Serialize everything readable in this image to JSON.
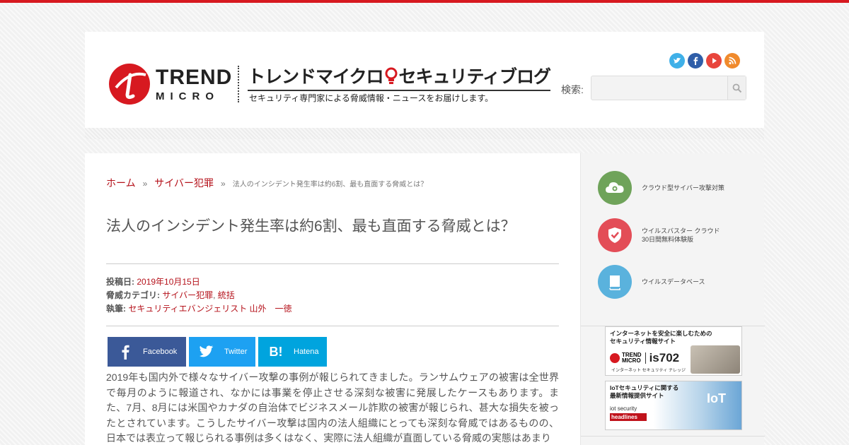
{
  "brand": {
    "logo_top": "TREND",
    "logo_bottom": "MICRO",
    "blog_title_pre": "トレンドマイクロ",
    "blog_title_post": "セキュリティブログ",
    "blog_subtitle": "セキュリティ専門家による脅威情報・ニュースをお届けします。",
    "accent_color": "#d71920"
  },
  "social_icons": [
    "twitter-icon",
    "facebook-icon",
    "youtube-icon",
    "rss-icon"
  ],
  "search": {
    "label": "検索:",
    "placeholder": ""
  },
  "breadcrumb": {
    "home": "ホーム",
    "category": "サイバー犯罪",
    "separator": "»",
    "current": "法人のインシデント発生率は約6割、最も直面する脅威とは？"
  },
  "post": {
    "title": "法人のインシデント発生率は約6割、最も直面する脅威とは？",
    "date_label": "投稿日:",
    "date": "2019年10月15日",
    "category_label": "脅威カテゴリ:",
    "categories": [
      "サイバー犯罪",
      "統括"
    ],
    "category_sep": ",",
    "author_label": "執筆:",
    "author": "セキュリティエバンジェリスト 山外　一徳",
    "body": "2019年も国内外で様々なサイバー攻撃の事例が報じられてきました。ランサムウェアの被害は全世界で毎月のように報道され、なかには事業を停止させる深刻な被害に発展したケースもあります。また、7月、8月には米国やカナダの自治体でビジネスメール詐欺の被害が報じられ、甚大な損失を被ったとされています。こうしたサイバー攻撃は国内の法人組織にとっても深刻な脅威ではあるものの、日本では表立って報じられる事例は多くはなく、実際に法人組織が直面している脅威の実態はあまり"
  },
  "share": {
    "facebook": "Facebook",
    "twitter": "Twitter",
    "hatena": "Hatena",
    "hatena_glyph": "B!",
    "facebook_color": "#3b5998",
    "twitter_color": "#1da1f2",
    "hatena_color": "#00a4de"
  },
  "sidebar": {
    "items": [
      {
        "label": "クラウド型サイバー攻撃対策",
        "color": "#6fa35a",
        "icon": "cloud-icon"
      },
      {
        "label_line1": "ウイルスバスター クラウド",
        "label_line2": "30日間無料体験版",
        "color": "#e34d57",
        "icon": "shield-icon"
      },
      {
        "label": "ウイルスデータベース",
        "color": "#5ab2dd",
        "icon": "book-icon"
      }
    ],
    "banners": [
      {
        "line1": "インターネットを安全に楽しむための",
        "line2": "セキュリティ情報サイト",
        "brand": "TREND",
        "brand2": "MICRO",
        "product": "is702",
        "tagline": "インターネット セキュリティ ナレッジ"
      },
      {
        "line1": "IoTセキュリティに関する",
        "line2": "最新情報提供サイト",
        "product_top": "iot",
        "product_mid": "security",
        "product_bottom": "headlines",
        "big": "IoT"
      }
    ]
  }
}
